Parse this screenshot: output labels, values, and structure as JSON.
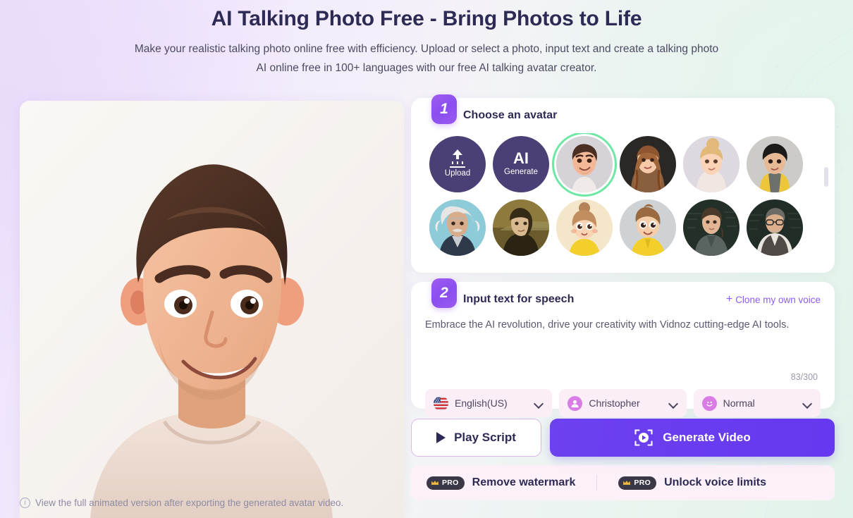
{
  "header": {
    "title": "AI Talking Photo Free - Bring Photos to Life",
    "subtitle_line1": "Make your realistic talking photo online free with efficiency. Upload or select a photo, input text and create a talking photo",
    "subtitle_line2": "AI online free in 100+ languages with our free AI talking avatar creator."
  },
  "preview": {
    "note": "View the full animated version after exporting the generated avatar video.",
    "info_icon": "info-icon"
  },
  "avatar_panel": {
    "step": "1",
    "title": "Choose an avatar",
    "actions": [
      {
        "name": "upload",
        "label": "Upload",
        "icon": "upload-arrow-icon"
      },
      {
        "name": "ai-generate",
        "big": "AI",
        "label": "Generate"
      }
    ],
    "avatars": [
      {
        "name": "young-man-cartoon",
        "selected": true
      },
      {
        "name": "woman-long-brown-hair",
        "selected": false
      },
      {
        "name": "woman-blonde-bun",
        "selected": false
      },
      {
        "name": "teen-boy-yellow-jacket",
        "selected": false
      },
      {
        "name": "einstein-portrait",
        "selected": false
      },
      {
        "name": "mona-lisa-painting",
        "selected": false
      },
      {
        "name": "girl-yellow-shirt",
        "selected": false
      },
      {
        "name": "boy-yellow-hoodie",
        "selected": false
      },
      {
        "name": "woman-teacher-chalkboard",
        "selected": false
      },
      {
        "name": "man-teacher-vest",
        "selected": false
      }
    ],
    "selected_index": 0
  },
  "speech_panel": {
    "step": "2",
    "title": "Input text for speech",
    "clone_link": "Clone my own voice",
    "clone_plus": "+",
    "text": "Embrace the AI revolution, drive your creativity with Vidnoz cutting-edge AI tools.",
    "char_count": "83/300",
    "selects": [
      {
        "name": "language-select",
        "value": "English(US)",
        "icon": "us-flag-icon"
      },
      {
        "name": "voice-select",
        "value": "Christopher",
        "icon": "person-icon"
      },
      {
        "name": "style-select",
        "value": "Normal",
        "icon": "smiley-icon"
      }
    ]
  },
  "actions": {
    "play_script": "Play Script",
    "generate_video": "Generate Video",
    "play_icon": "play-triangle-icon",
    "generate_icon": "video-capture-icon"
  },
  "pro_bar": {
    "badge_text": "PRO",
    "crown_icon": "crown-icon",
    "items": [
      {
        "name": "remove-watermark",
        "label": "Remove watermark"
      },
      {
        "name": "unlock-voice-limits",
        "label": "Unlock voice limits"
      }
    ]
  },
  "colors": {
    "accent_purple": "#6c41ef",
    "link_purple": "#8b5cf6",
    "title_navy": "#2d2a55",
    "selected_green": "#6ee7a4",
    "pro_dark": "#3a3747",
    "crown_gold": "#f0b93b"
  }
}
